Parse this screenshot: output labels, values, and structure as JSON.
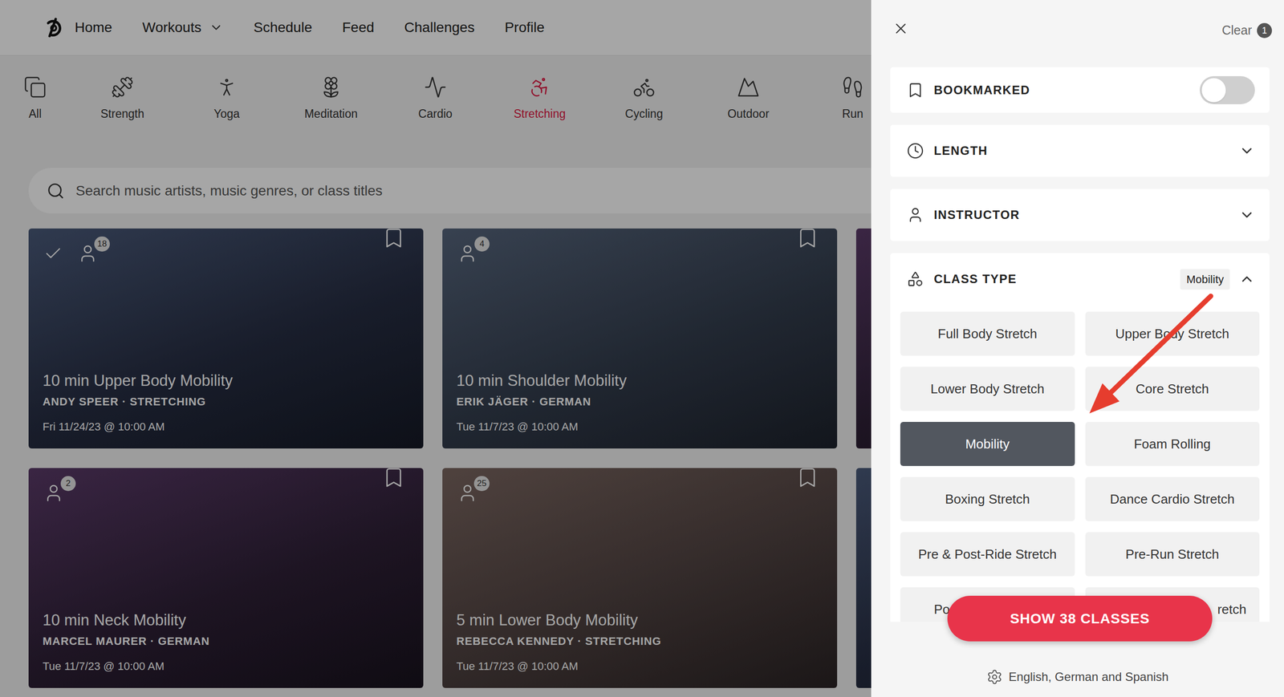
{
  "nav": {
    "items": [
      {
        "label": "Home",
        "kind": "link"
      },
      {
        "label": "Workouts",
        "kind": "dropdown"
      },
      {
        "label": "Schedule",
        "kind": "link"
      },
      {
        "label": "Feed",
        "kind": "link"
      },
      {
        "label": "Challenges",
        "kind": "link"
      },
      {
        "label": "Profile",
        "kind": "link"
      }
    ]
  },
  "categories": [
    {
      "label": "All",
      "selected": false
    },
    {
      "label": "Strength",
      "selected": false
    },
    {
      "label": "Yoga",
      "selected": false
    },
    {
      "label": "Meditation",
      "selected": false
    },
    {
      "label": "Cardio",
      "selected": false
    },
    {
      "label": "Stretching",
      "selected": true
    },
    {
      "label": "Cycling",
      "selected": false
    },
    {
      "label": "Outdoor",
      "selected": false
    },
    {
      "label": "Run",
      "selected": false
    }
  ],
  "search": {
    "placeholder": "Search music artists, music genres, or class titles"
  },
  "cards": [
    {
      "title": "10 min Upper Body Mobility",
      "subtitle": "ANDY SPEER · STRETCHING",
      "date": "Fri 11/24/23 @ 10:00 AM",
      "participants": "18",
      "completed": true
    },
    {
      "title": "10 min Shoulder Mobility",
      "subtitle": "ERIK JÄGER · GERMAN",
      "date": "Tue 11/7/23 @ 10:00 AM",
      "participants": "4",
      "completed": false
    },
    {
      "title": "10 min Neck Mobility",
      "subtitle": "MARCEL MAURER · GERMAN",
      "date": "Tue 11/7/23 @ 10:00 AM",
      "participants": "2",
      "completed": false
    },
    {
      "title": "5 min Lower Body Mobility",
      "subtitle": "REBECCA KENNEDY · STRETCHING",
      "date": "Tue 11/7/23 @ 10:00 AM",
      "participants": "25",
      "completed": false
    }
  ],
  "filters": {
    "clear": {
      "label": "Clear",
      "count": "1"
    },
    "bookmarked": {
      "label": "BOOKMARKED",
      "on": false
    },
    "sections": [
      {
        "label": "LENGTH",
        "expanded": false
      },
      {
        "label": "INSTRUCTOR",
        "expanded": false
      }
    ],
    "class_type": {
      "label": "CLASS TYPE",
      "value": "Mobility",
      "expanded": true,
      "options": [
        {
          "label": "Full Body Stretch",
          "selected": false,
          "kind": "full"
        },
        {
          "label": "Upper Body Stretch",
          "selected": false,
          "kind": "full"
        },
        {
          "label": "Lower Body Stretch",
          "selected": false,
          "kind": "full"
        },
        {
          "label": "Core Stretch",
          "selected": false,
          "kind": "full"
        },
        {
          "label": "Mobility",
          "selected": true,
          "kind": "full"
        },
        {
          "label": "Foam Rolling",
          "selected": false,
          "kind": "full"
        },
        {
          "label": "Boxing Stretch",
          "selected": false,
          "kind": "full"
        },
        {
          "label": "Dance Cardio Stretch",
          "selected": false,
          "kind": "full"
        },
        {
          "label": "Pre & Post-Ride Stretch",
          "selected": false,
          "kind": "full"
        },
        {
          "label": "Pre-Run Stretch",
          "selected": false,
          "kind": "full"
        },
        {
          "label": "Po",
          "selected": false,
          "kind": "start"
        },
        {
          "label": "retch",
          "selected": false,
          "kind": "end"
        }
      ]
    },
    "show_button": "SHOW 38 CLASSES",
    "language": "English, German and Spanish"
  }
}
